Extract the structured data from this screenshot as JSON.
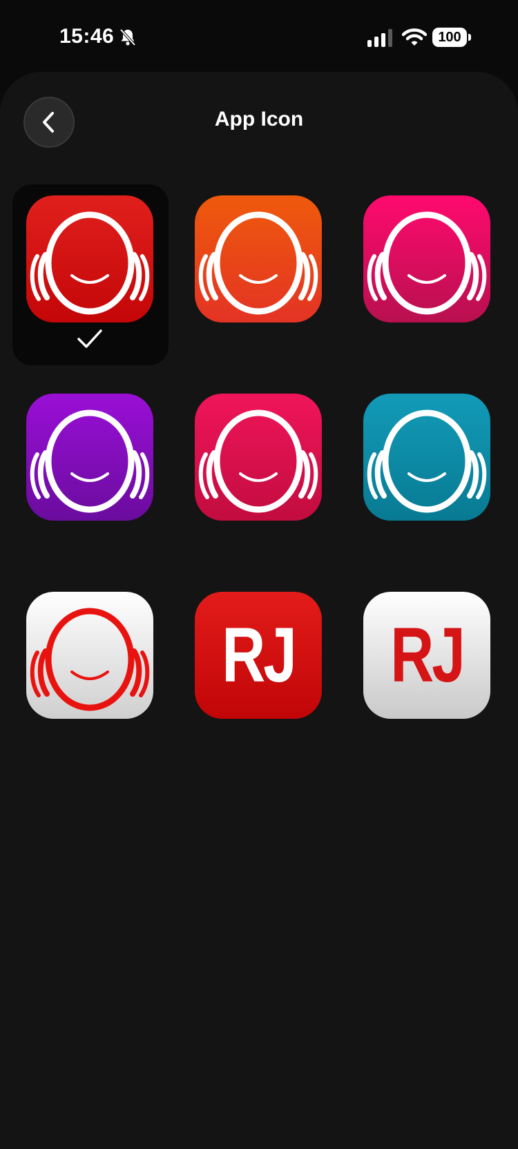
{
  "status_bar": {
    "time": "15:46",
    "battery": "100",
    "icons": [
      "bell-slash-icon",
      "cellular-signal-icon",
      "wifi-icon",
      "battery-icon"
    ]
  },
  "header": {
    "title": "App Icon",
    "back_icon": "chevron-left-icon"
  },
  "icons": [
    {
      "id": "red",
      "style": "headphones",
      "top": "#e0201c",
      "bottom": "#c40608",
      "fg": "#ffffff",
      "selected": true
    },
    {
      "id": "orange",
      "style": "headphones",
      "top": "#ef5a0c",
      "bottom": "#e33324",
      "fg": "#ffffff",
      "selected": false
    },
    {
      "id": "pink",
      "style": "headphones",
      "top": "#ff0a6e",
      "bottom": "#b8104f",
      "fg": "#ffffff",
      "selected": false
    },
    {
      "id": "purple",
      "style": "headphones",
      "top": "#9a0fd6",
      "bottom": "#6a0c9e",
      "fg": "#ffffff",
      "selected": false
    },
    {
      "id": "crimson",
      "style": "headphones",
      "top": "#f0155a",
      "bottom": "#c20c3f",
      "fg": "#ffffff",
      "selected": false
    },
    {
      "id": "teal",
      "style": "headphones",
      "top": "#129bb8",
      "bottom": "#087a93",
      "fg": "#ffffff",
      "selected": false
    },
    {
      "id": "white",
      "style": "headphones",
      "top": "#ffffff",
      "bottom": "#cfcfcf",
      "fg": "#e8130f",
      "selected": false
    },
    {
      "id": "rj-red",
      "style": "rj",
      "text": "RJ",
      "top": "#e31c1a",
      "bottom": "#c10507",
      "fg": "#ffffff",
      "selected": false
    },
    {
      "id": "rj-white",
      "style": "rj",
      "text": "RJ",
      "top": "#ffffff",
      "bottom": "#c9c9c9",
      "fg": "#d51416",
      "selected": false
    }
  ],
  "selected_check_icon": "checkmark-icon"
}
